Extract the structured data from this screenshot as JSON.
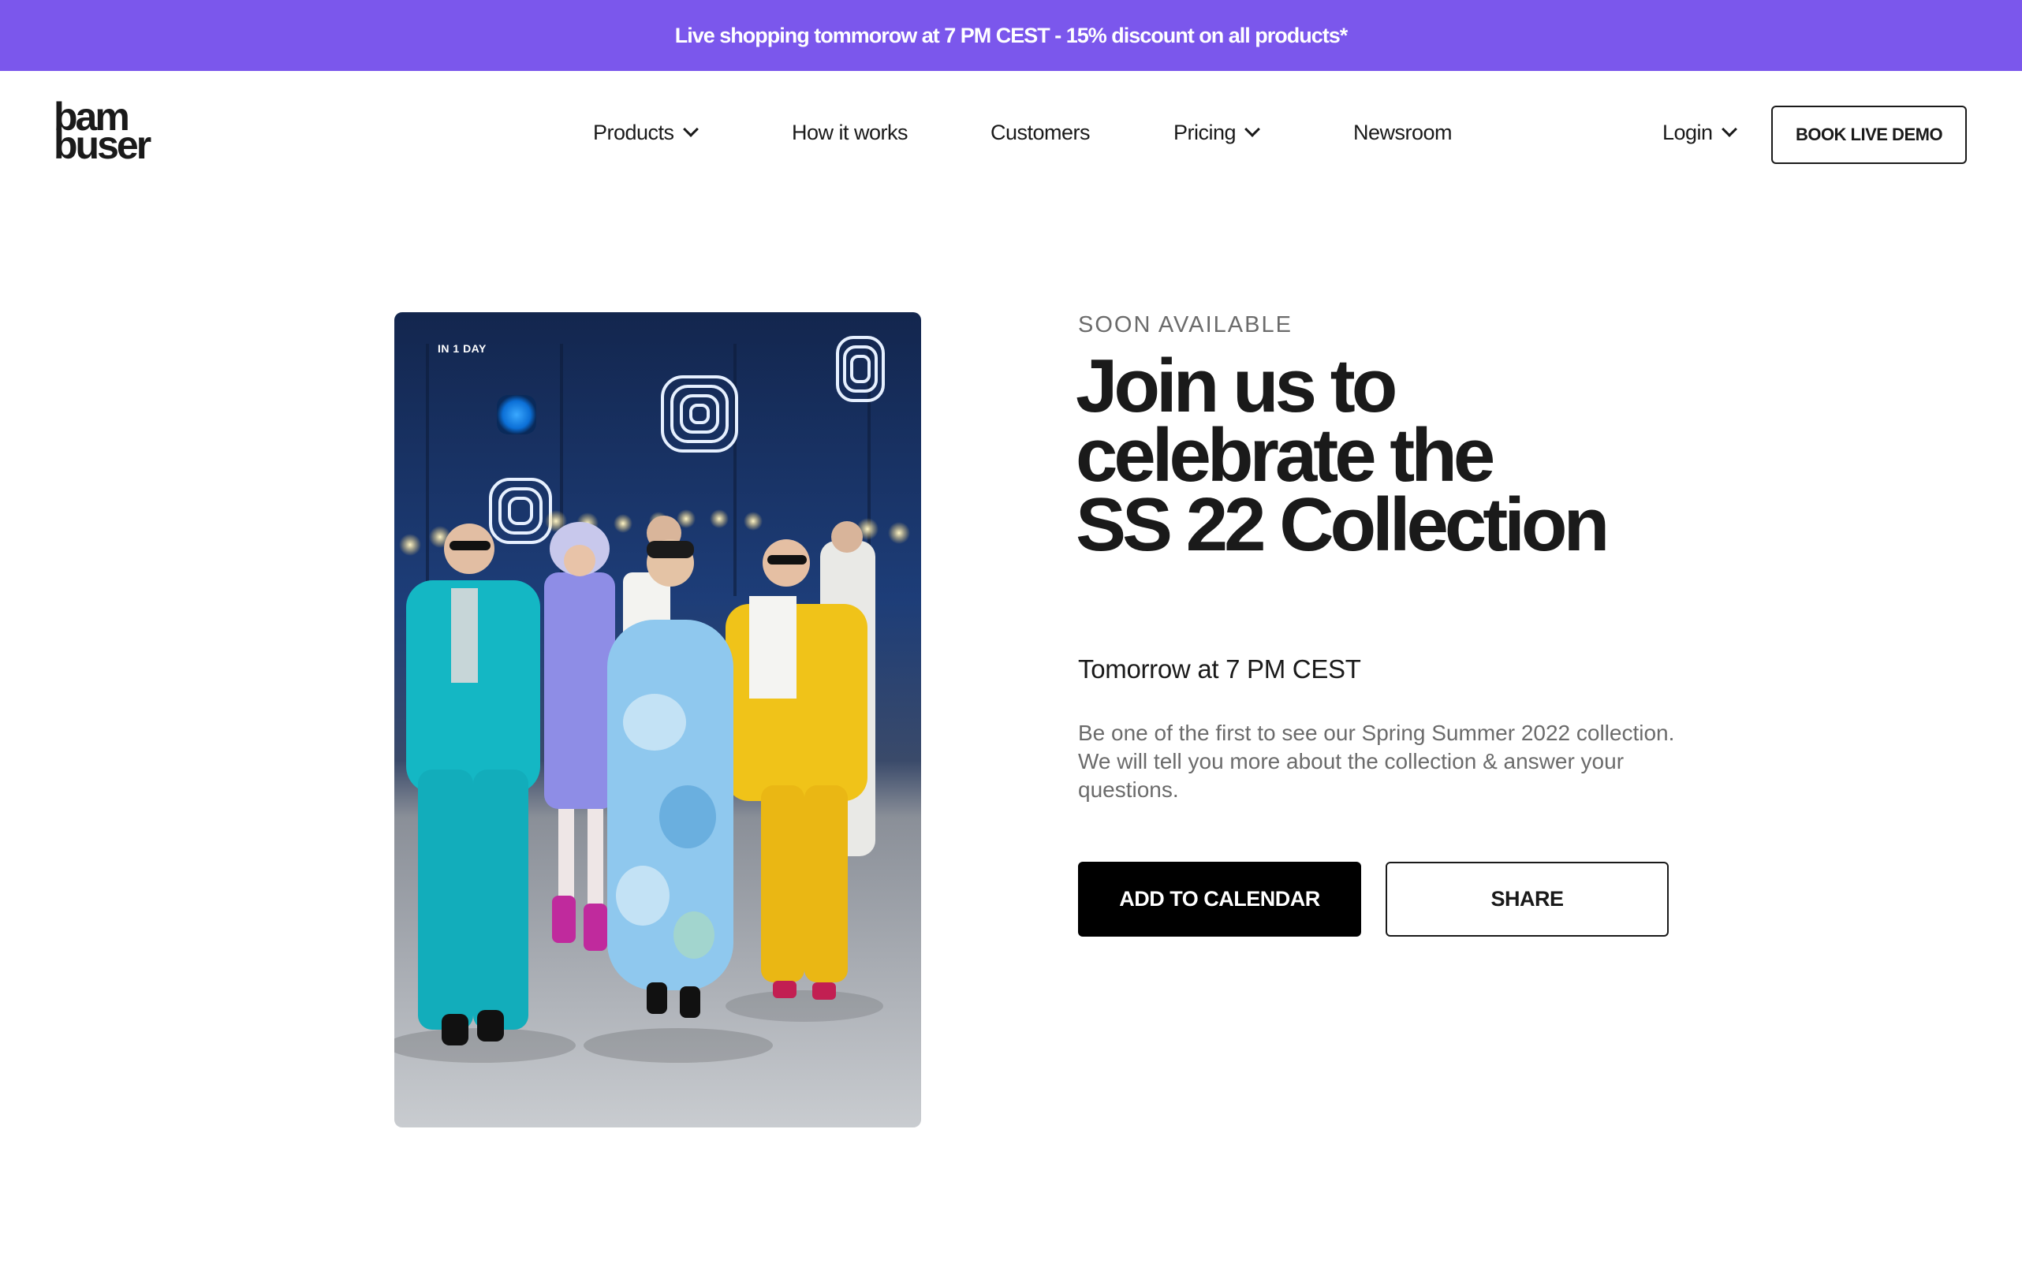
{
  "promo": {
    "text": "Live shopping tommorow at 7 PM CEST - 15% discount on all products*"
  },
  "brand": {
    "logo_line1": "bam",
    "logo_line2": "buser"
  },
  "nav": {
    "items": [
      {
        "label": "Products",
        "dropdown": true
      },
      {
        "label": "How it works",
        "dropdown": false
      },
      {
        "label": "Customers",
        "dropdown": false
      },
      {
        "label": "Pricing",
        "dropdown": true
      },
      {
        "label": "Newsroom",
        "dropdown": false
      }
    ],
    "login_label": "Login",
    "demo_label": "BOOK LIVE DEMO"
  },
  "hero": {
    "badge": "IN 1 DAY",
    "eyebrow": "SOON AVAILABLE",
    "headline_line1": "Join us to",
    "headline_line2": "celebrate the",
    "headline_line3": "SS 22 Collection",
    "time": "Tomorrow at 7 PM CEST",
    "description": "Be one of the first to see our Spring Summer 2022 collection. We will tell you more about the collection & answer your questions.",
    "primary_button": "ADD TO CALENDAR",
    "secondary_button": "SHARE"
  },
  "colors": {
    "promo_bg": "#7b57ec",
    "primary_button_bg": "#000000",
    "text": "#1a1a1a",
    "muted": "#6b6b6b"
  },
  "icons": {
    "dropdown": "chevron-down-icon"
  }
}
